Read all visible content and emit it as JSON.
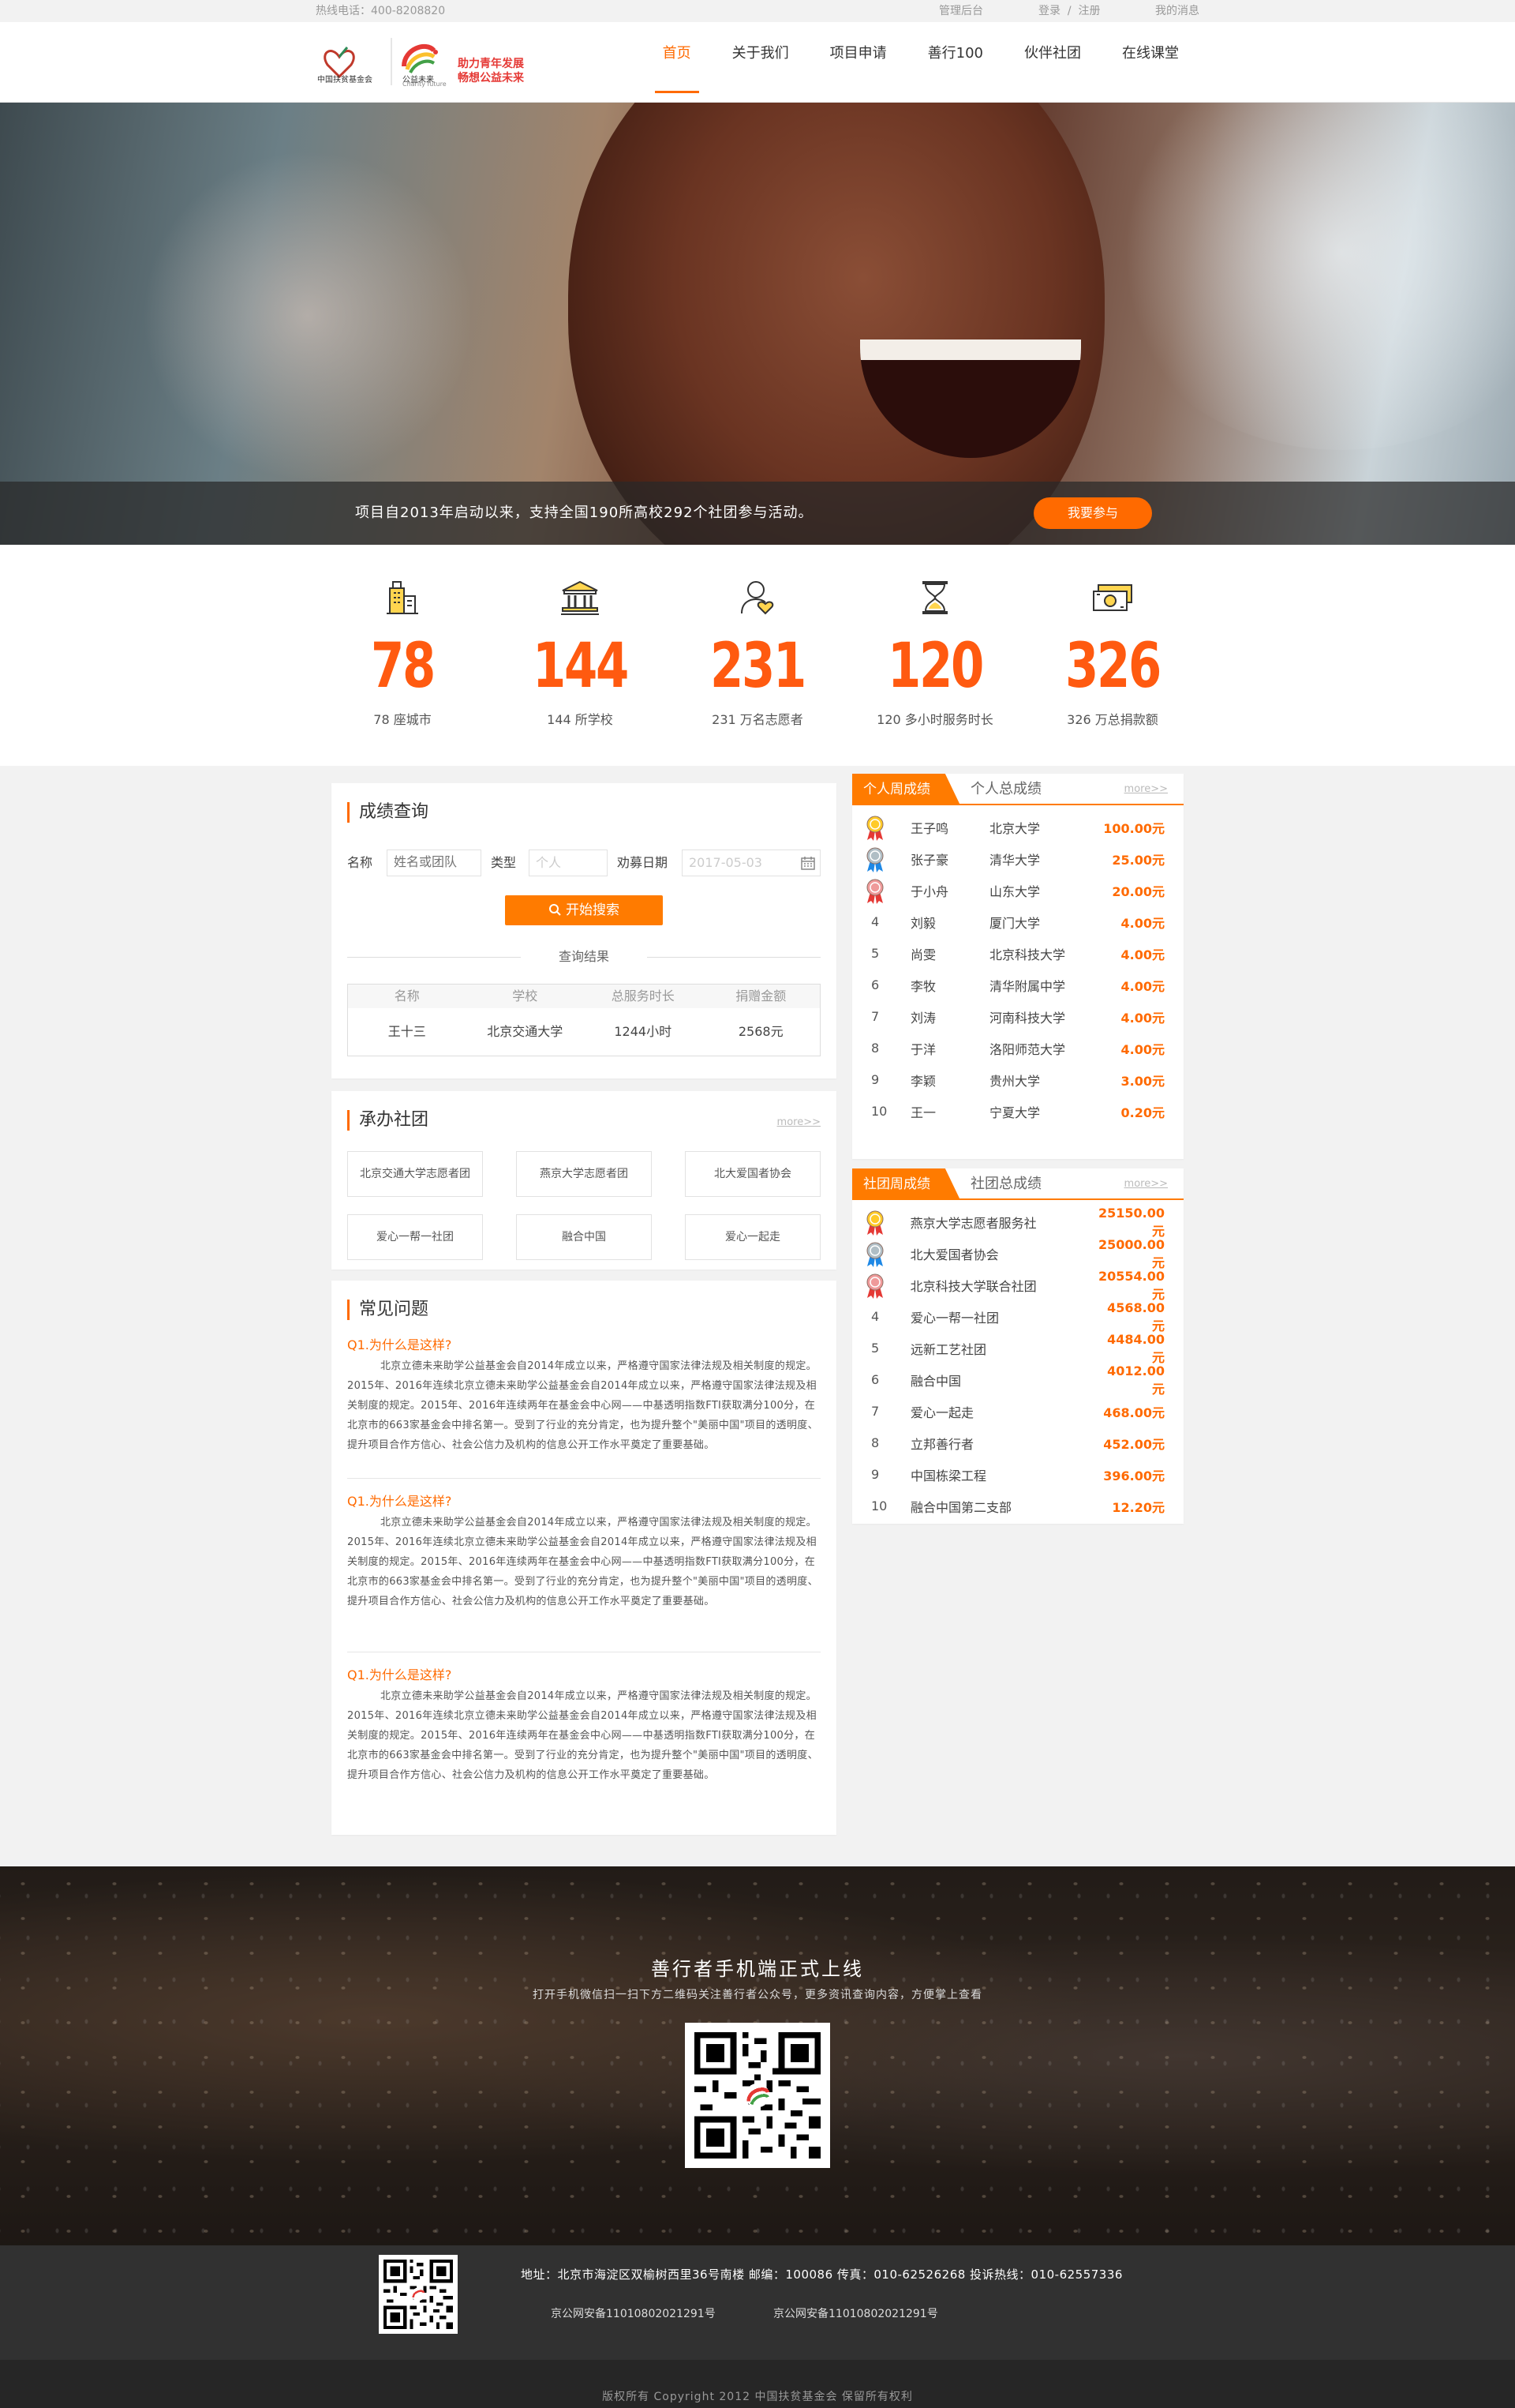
{
  "topbar": {
    "hotline": "热线电话：400-8208820",
    "admin": "管理后台",
    "login": "登录",
    "sep": "/",
    "register": "注册",
    "messages": "我的消息"
  },
  "header": {
    "slogan_line1": "助力青年发展",
    "slogan_line2": "畅想公益未来",
    "brand_small": "公益未来",
    "brand_en": "Charity future",
    "org_small": "中国扶贫基金会"
  },
  "nav": [
    {
      "label": "首页"
    },
    {
      "label": "关于我们"
    },
    {
      "label": "项目申请"
    },
    {
      "label": "善行100"
    },
    {
      "label": "伙伴社团"
    },
    {
      "label": "在线课堂"
    }
  ],
  "banner": {
    "caption": "项目自2013年启动以来，支持全国190所高校292个社团参与活动。",
    "cta": "我要参与",
    "slides": 3,
    "active_slide": 1
  },
  "stats": [
    {
      "icon": "building-icon",
      "value": "78",
      "label": "78 座城市"
    },
    {
      "icon": "school-icon",
      "value": "144",
      "label": "144 所学校"
    },
    {
      "icon": "volunteer-icon",
      "value": "231",
      "label": "231 万名志愿者"
    },
    {
      "icon": "hourglass-icon",
      "value": "120",
      "label": "120 多小时服务时长"
    },
    {
      "icon": "money-icon",
      "value": "326",
      "label": "326 万总捐款额"
    }
  ],
  "query": {
    "title": "成绩查询",
    "name_label": "名称",
    "name_placeholder": "姓名或团队",
    "type_label": "类型",
    "type_value": "个人",
    "date_label": "劝募日期",
    "date_value": "2017-05-03",
    "search_btn": "开始搜索",
    "result_title": "查询结果",
    "columns": [
      "名称",
      "学校",
      "总服务时长",
      "捐赠金额"
    ],
    "row": [
      "王十三",
      "北京交通大学",
      "1244小时",
      "2568元"
    ]
  },
  "clubs": {
    "title": "承办社团",
    "more": "more>>",
    "items": [
      "北京交通大学志愿者团",
      "燕京大学志愿者团",
      "北大爱国者协会",
      "爱心一帮一社团",
      "融合中国",
      "爱心一起走"
    ]
  },
  "faq": {
    "title": "常见问题",
    "items": [
      {
        "q": "Q1.为什么是这样?",
        "a": "北京立德未来助学公益基金会自2014年成立以来，严格遵守国家法律法规及相关制度的规定。2015年、2016年连续北京立德未来助学公益基金会自2014年成立以来，严格遵守国家法律法规及相关制度的规定。2015年、2016年连续两年在基金会中心网——中基透明指数FTI获取满分100分，在北京市的663家基金会中排名第一。受到了行业的充分肯定，也为提升整个\"美丽中国\"项目的透明度、提升项目合作方信心、社会公信力及机构的信息公开工作水平奠定了重要基础。"
      },
      {
        "q": "Q1.为什么是这样?",
        "a": "北京立德未来助学公益基金会自2014年成立以来，严格遵守国家法律法规及相关制度的规定。2015年、2016年连续北京立德未来助学公益基金会自2014年成立以来，严格遵守国家法律法规及相关制度的规定。2015年、2016年连续两年在基金会中心网——中基透明指数FTI获取满分100分，在北京市的663家基金会中排名第一。受到了行业的充分肯定，也为提升整个\"美丽中国\"项目的透明度、提升项目合作方信心、社会公信力及机构的信息公开工作水平奠定了重要基础。"
      },
      {
        "q": "Q1.为什么是这样?",
        "a": "北京立德未来助学公益基金会自2014年成立以来，严格遵守国家法律法规及相关制度的规定。2015年、2016年连续北京立德未来助学公益基金会自2014年成立以来，严格遵守国家法律法规及相关制度的规定。2015年、2016年连续两年在基金会中心网——中基透明指数FTI获取满分100分，在北京市的663家基金会中排名第一。受到了行业的充分肯定，也为提升整个\"美丽中国\"项目的透明度、提升项目合作方信心、社会公信力及机构的信息公开工作水平奠定了重要基础。"
      }
    ]
  },
  "rank_personal": {
    "tab_active": "个人周成绩",
    "tab_other": "个人总成绩",
    "more": "more>>",
    "rows": [
      {
        "rank": "1",
        "name": "王子鸣",
        "school": "北京大学",
        "amount": "100.00元"
      },
      {
        "rank": "2",
        "name": "张子豪",
        "school": "清华大学",
        "amount": "25.00元"
      },
      {
        "rank": "3",
        "name": "于小舟",
        "school": "山东大学",
        "amount": "20.00元"
      },
      {
        "rank": "4",
        "name": "刘毅",
        "school": "厦门大学",
        "amount": "4.00元"
      },
      {
        "rank": "5",
        "name": "尚雯",
        "school": "北京科技大学",
        "amount": "4.00元"
      },
      {
        "rank": "6",
        "name": "李牧",
        "school": "清华附属中学",
        "amount": "4.00元"
      },
      {
        "rank": "7",
        "name": "刘涛",
        "school": "河南科技大学",
        "amount": "4.00元"
      },
      {
        "rank": "8",
        "name": "于洋",
        "school": "洛阳师范大学",
        "amount": "4.00元"
      },
      {
        "rank": "9",
        "name": "李颖",
        "school": "贵州大学",
        "amount": "3.00元"
      },
      {
        "rank": "10",
        "name": "王一",
        "school": "宁夏大学",
        "amount": "0.20元"
      }
    ]
  },
  "rank_club": {
    "tab_active": "社团周成绩",
    "tab_other": "社团总成绩",
    "more": "more>>",
    "rows": [
      {
        "rank": "1",
        "name": "燕京大学志愿者服务社",
        "amount": "25150.00元"
      },
      {
        "rank": "2",
        "name": "北大爱国者协会",
        "amount": "25000.00元"
      },
      {
        "rank": "3",
        "name": "北京科技大学联合社团",
        "amount": "20554.00元"
      },
      {
        "rank": "4",
        "name": "爱心一帮一社团",
        "amount": "4568.00元"
      },
      {
        "rank": "5",
        "name": "远新工艺社团",
        "amount": "4484.00元"
      },
      {
        "rank": "6",
        "name": "融合中国",
        "amount": "4012.00元"
      },
      {
        "rank": "7",
        "name": "爱心一起走",
        "amount": "468.00元"
      },
      {
        "rank": "8",
        "name": "立邦善行者",
        "amount": "452.00元"
      },
      {
        "rank": "9",
        "name": "中国栋梁工程",
        "amount": "396.00元"
      },
      {
        "rank": "10",
        "name": "融合中国第二支部",
        "amount": "12.20元"
      }
    ]
  },
  "promo": {
    "title": "善行者手机端正式上线",
    "subtitle": "打开手机微信扫一扫下方二维码关注善行者公众号，更多资讯查询内容，方便掌上查看"
  },
  "footer": {
    "address": "地址：北京市海淀区双榆树西里36号南楼 邮编：100086 传真：010-62526268 投诉热线：010-62557336",
    "icp1": "京公网安备11010802021291号",
    "icp2": "京公网安备11010802021291号",
    "copyright": "版权所有 Copyright 2012 中国扶贫基金会 保留所有权利"
  },
  "colors": {
    "accent": "#ff6a00",
    "footer": "#313131",
    "copyright": "#262626"
  }
}
